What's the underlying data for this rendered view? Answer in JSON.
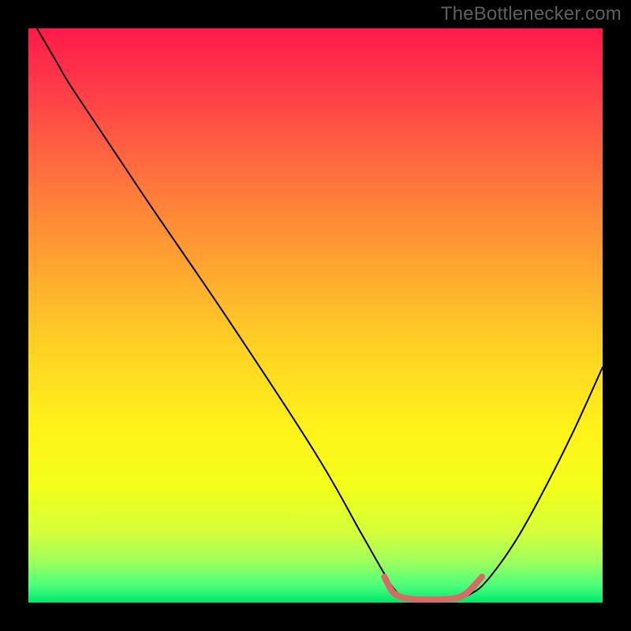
{
  "watermark": "TheBottlenecker.com",
  "chart_data": {
    "type": "line",
    "title": "",
    "xlabel": "",
    "ylabel": "",
    "xlim": [
      0,
      100
    ],
    "ylim": [
      0,
      100
    ],
    "gradient_stops": [
      {
        "offset": 0.0,
        "color": "#ff1a4b"
      },
      {
        "offset": 0.1,
        "color": "#ff3a49"
      },
      {
        "offset": 0.25,
        "color": "#ff6f3e"
      },
      {
        "offset": 0.4,
        "color": "#ffa031"
      },
      {
        "offset": 0.55,
        "color": "#ffd024"
      },
      {
        "offset": 0.7,
        "color": "#fff31a"
      },
      {
        "offset": 0.8,
        "color": "#f3ff1a"
      },
      {
        "offset": 0.88,
        "color": "#d3ff3a"
      },
      {
        "offset": 0.93,
        "color": "#9cff5f"
      },
      {
        "offset": 0.97,
        "color": "#4dff7c"
      },
      {
        "offset": 1.0,
        "color": "#00e66b"
      }
    ],
    "series": [
      {
        "name": "bottleneck-curve",
        "stroke": "#000000",
        "stroke_width": 2,
        "points": [
          {
            "x": 1.5,
            "y": 100
          },
          {
            "x": 5,
            "y": 94
          },
          {
            "x": 8,
            "y": 89
          },
          {
            "x": 20,
            "y": 71
          },
          {
            "x": 35,
            "y": 49
          },
          {
            "x": 50,
            "y": 26
          },
          {
            "x": 58,
            "y": 12
          },
          {
            "x": 62,
            "y": 5
          },
          {
            "x": 64,
            "y": 2
          },
          {
            "x": 66,
            "y": 0.6
          },
          {
            "x": 70,
            "y": 0.3
          },
          {
            "x": 74,
            "y": 0.5
          },
          {
            "x": 77,
            "y": 1.5
          },
          {
            "x": 80,
            "y": 4
          },
          {
            "x": 85,
            "y": 11
          },
          {
            "x": 90,
            "y": 20
          },
          {
            "x": 95,
            "y": 30
          },
          {
            "x": 100,
            "y": 41
          }
        ]
      },
      {
        "name": "optimal-band",
        "stroke": "#d86a68",
        "stroke_width": 8,
        "points": [
          {
            "x": 62,
            "y": 4.5
          },
          {
            "x": 63,
            "y": 2.5
          },
          {
            "x": 64,
            "y": 1.4
          },
          {
            "x": 66,
            "y": 0.7
          },
          {
            "x": 70,
            "y": 0.5
          },
          {
            "x": 74,
            "y": 0.7
          },
          {
            "x": 76,
            "y": 1.4
          },
          {
            "x": 77.5,
            "y": 2.8
          },
          {
            "x": 79,
            "y": 4.5
          }
        ]
      }
    ]
  }
}
